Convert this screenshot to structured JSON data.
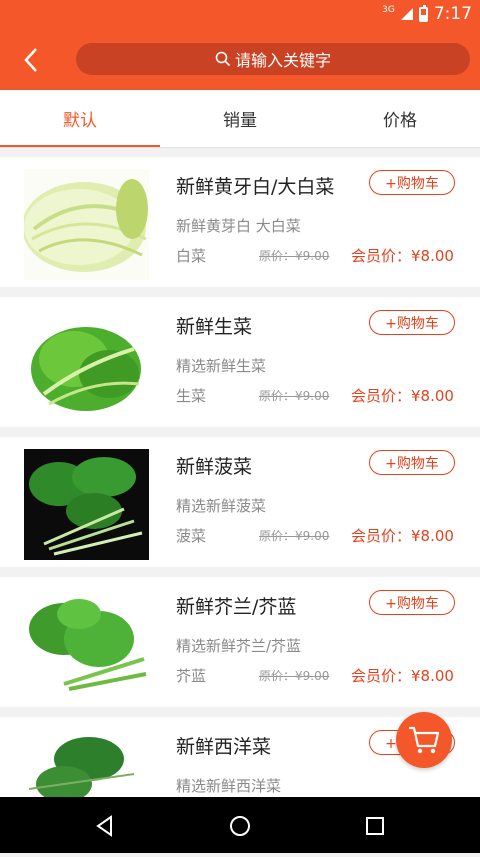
{
  "status": {
    "time": "7:17",
    "network": "3G"
  },
  "header": {
    "search_placeholder": "请输入关键字"
  },
  "tabs": [
    {
      "label": "默认",
      "active": true
    },
    {
      "label": "销量",
      "active": false
    },
    {
      "label": "价格",
      "active": false
    }
  ],
  "items": [
    {
      "title": "新鲜黄牙白/大白菜",
      "subtitle": "新鲜黄芽白 大白菜",
      "tag": "白菜",
      "old_price": "原价：¥9.00",
      "price": "会员价：¥8.00",
      "cart": "+购物车"
    },
    {
      "title": "新鲜生菜",
      "subtitle": "精选新鲜生菜",
      "tag": "生菜",
      "old_price": "原价：¥9.00",
      "price": "会员价：¥8.00",
      "cart": "+购物车"
    },
    {
      "title": "新鲜菠菜",
      "subtitle": "精选新鲜菠菜",
      "tag": "菠菜",
      "old_price": "原价：¥9.00",
      "price": "会员价：¥8.00",
      "cart": "+购物车"
    },
    {
      "title": "新鲜芥兰/芥蓝",
      "subtitle": "精选新鲜芥兰/芥蓝",
      "tag": "芥蓝",
      "old_price": "原价：¥9.00",
      "price": "会员价：¥8.00",
      "cart": "+购物车"
    },
    {
      "title": "新鲜西洋菜",
      "subtitle": "精选新鲜西洋菜",
      "tag": "",
      "old_price": "",
      "price": "",
      "cart": "+购物车"
    }
  ],
  "colors": {
    "accent": "#f4582a",
    "price": "#e5421c"
  }
}
